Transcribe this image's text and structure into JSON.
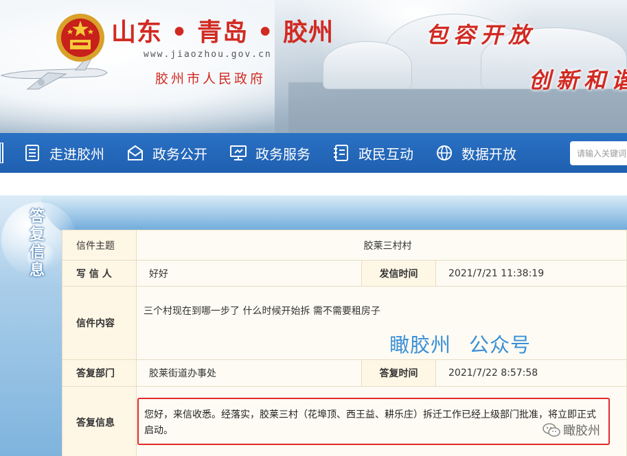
{
  "header": {
    "title": "山东 • 青岛 • 胶州",
    "url": "www.jiaozhou.gov.cn",
    "gov_name": "胶州市人民政府",
    "slogan_1": "包容开放",
    "slogan_2": "创新和谐",
    "emblem_icon": "national-emblem",
    "brand_red": "#d12a22"
  },
  "nav": {
    "items": [
      {
        "label": "走进胶州",
        "icon": "document-list-icon"
      },
      {
        "label": "政务公开",
        "icon": "envelope-open-icon"
      },
      {
        "label": "政务服务",
        "icon": "monitor-icon"
      },
      {
        "label": "政民互动",
        "icon": "notebook-icon"
      },
      {
        "label": "数据开放",
        "icon": "globe-icon"
      }
    ],
    "search_placeholder": "请输入关键词",
    "bar_color": "#2268b8"
  },
  "panel": {
    "side_title": [
      "答",
      "复",
      "信",
      "息"
    ]
  },
  "letter": {
    "subject_label": "信件主题",
    "subject": "胶莱三村村",
    "writer_label": "写 信 人",
    "writer": "好好",
    "sent_time_label": "发信时间",
    "sent_time": "2021/7/21 11:38:19",
    "content_label": "信件内容",
    "content": "三个村现在到哪一步了 什么时候开始拆 需不需要租房子",
    "reply_dept_label": "答复部门",
    "reply_dept": "胶莱街道办事处",
    "reply_time_label": "答复时间",
    "reply_time": "2021/7/22 8:57:58",
    "reply_info_label": "答复信息",
    "reply_info": "您好，来信收悉。经落实，胶莱三村（花埠顶、西王益、耕乐庄）拆迁工作已经上级部门批准，将立即正式启动。"
  },
  "overlay": {
    "watermark_left": "瞰胶州",
    "watermark_right": "公众号",
    "wechat_label": "瞰胶州",
    "highlight_color": "#e02a2a"
  }
}
